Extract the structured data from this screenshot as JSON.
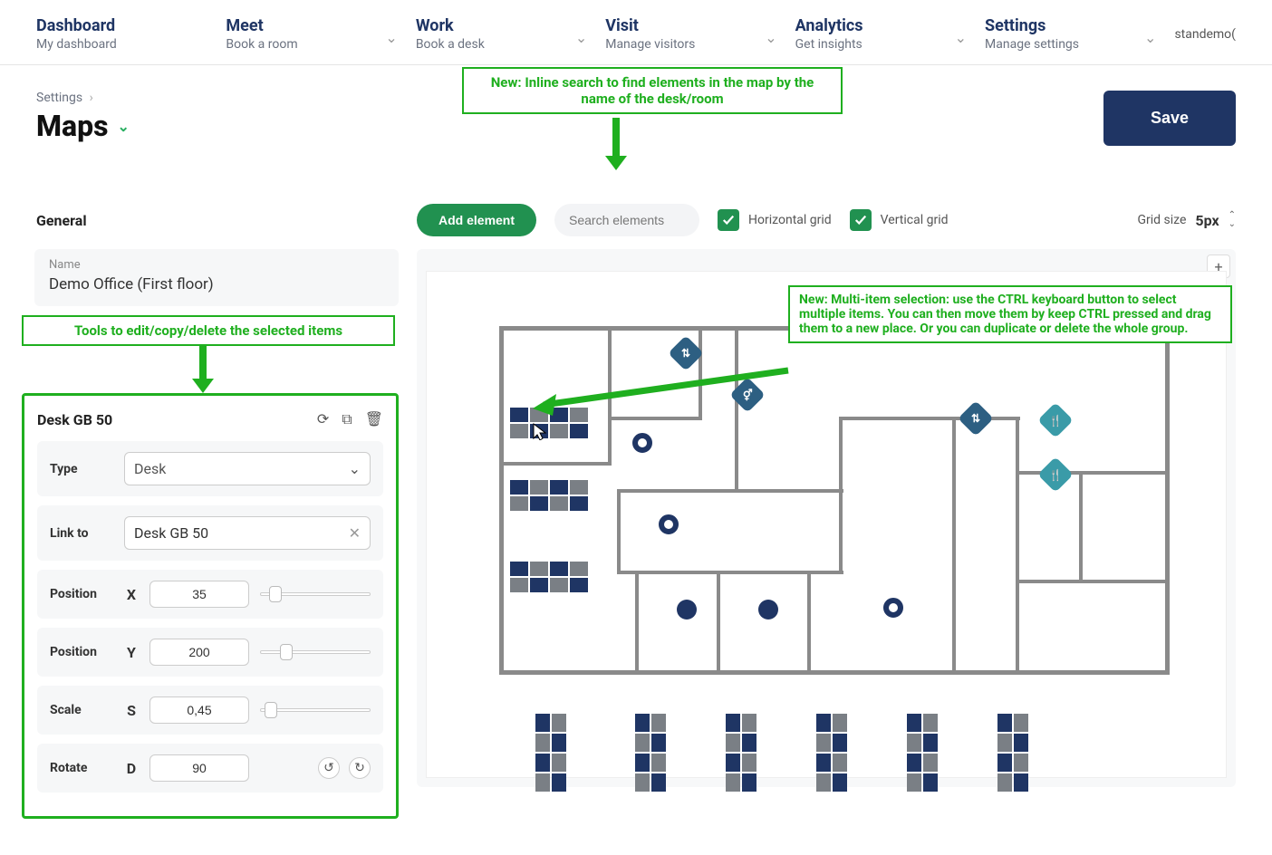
{
  "nav": {
    "items": [
      {
        "title": "Dashboard",
        "sub": "My dashboard"
      },
      {
        "title": "Meet",
        "sub": "Book a room"
      },
      {
        "title": "Work",
        "sub": "Book a desk"
      },
      {
        "title": "Visit",
        "sub": "Manage visitors"
      },
      {
        "title": "Analytics",
        "sub": "Get insights"
      },
      {
        "title": "Settings",
        "sub": "Manage settings"
      }
    ],
    "user": "standemo("
  },
  "breadcrumb": {
    "parent": "Settings"
  },
  "page": {
    "title": "Maps",
    "save_btn": "Save"
  },
  "annotations": {
    "search_hint": "New: Inline search to find elements in the map by the name of the desk/room",
    "tools_hint": "Tools to edit/copy/delete the selected items",
    "multiselect_hint": "New: Multi-item selection: use the CTRL keyboard button to select multiple items. You can then move them by keep CTRL pressed and drag them to a new place. Or you can duplicate or delete the whole group."
  },
  "toolbar": {
    "general_label": "General",
    "add_element": "Add element",
    "search_placeholder": "Search elements",
    "horiz_grid": "Horizontal grid",
    "vert_grid": "Vertical grid",
    "grid_size_label": "Grid size",
    "grid_size_value": "5px"
  },
  "map_name": {
    "label": "Name",
    "value": "Demo Office (First floor)"
  },
  "selected": {
    "name": "Desk GB 50",
    "type_label": "Type",
    "type_value": "Desk",
    "link_label": "Link to",
    "link_value": "Desk GB 50",
    "pos_x_label": "Position",
    "pos_x_axis": "X",
    "pos_x_val": "35",
    "pos_y_label": "Position",
    "pos_y_axis": "Y",
    "pos_y_val": "200",
    "scale_label": "Scale",
    "scale_axis": "S",
    "scale_val": "0,45",
    "rotate_label": "Rotate",
    "rotate_axis": "D",
    "rotate_val": "90"
  },
  "colors": {
    "brand": "#1f3564",
    "green": "#219150",
    "anno": "#1FAF1F"
  }
}
